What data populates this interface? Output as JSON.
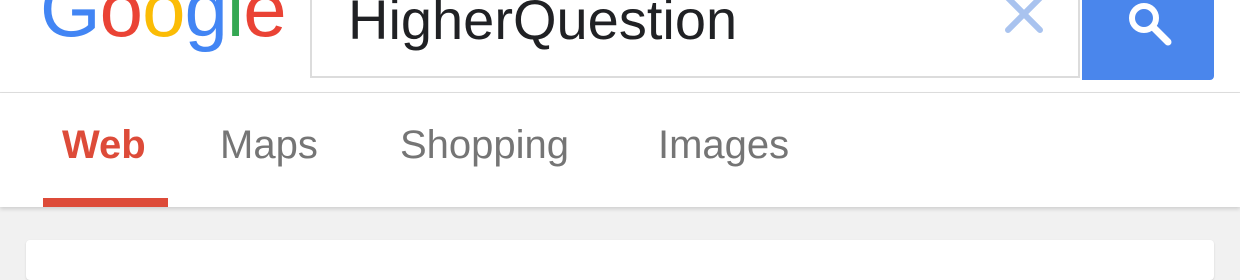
{
  "header": {
    "logo_letters": [
      {
        "char": "G",
        "color": "#4285f4"
      },
      {
        "char": "o",
        "color": "#ea4335"
      },
      {
        "char": "o",
        "color": "#fbbc05"
      },
      {
        "char": "g",
        "color": "#4285f4"
      },
      {
        "char": "l",
        "color": "#34a853"
      },
      {
        "char": "e",
        "color": "#ea4335"
      }
    ],
    "search": {
      "value": "HigherQuestion",
      "clear_icon": "close-icon",
      "search_icon": "search-icon",
      "button_color": "#4a86ec"
    }
  },
  "tabs": [
    {
      "label": "Web",
      "active": true
    },
    {
      "label": "Maps",
      "active": false
    },
    {
      "label": "Shopping",
      "active": false
    },
    {
      "label": "Images",
      "active": false
    }
  ],
  "colors": {
    "active_tab": "#dd4b39",
    "inactive_tab": "#757575",
    "clear_icon": "#a9c3ef"
  }
}
